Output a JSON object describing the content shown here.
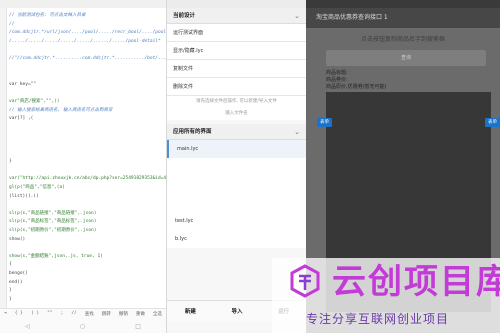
{
  "editor": {
    "status_bar_text": "",
    "lines": [
      {
        "text": "// 当前测试包名: 可点击文档入目录",
        "cls": "c-comment"
      },
      {
        "text": "//",
        "cls": "c-comment"
      },
      {
        "text": "/com.ddcjtr.*/url/json/..../pool/...../recr_bool/..../pool/...../auto-trend*",
        "cls": "c-comment"
      },
      {
        "text": "/...../...../...../...../...../....../...../pool-detail*",
        "cls": "c-comment"
      },
      {
        "text": "",
        "cls": ""
      },
      {
        "text": "//\"//com.ddcjtr.*..........com.ddcjtr.*.........../bot/.../pool/...../trendyPoolBest*",
        "cls": "c-comment"
      },
      {
        "text": "",
        "cls": ""
      },
      {
        "text": "",
        "cls": ""
      },
      {
        "text": "var key=\"\"",
        "cls": "c-kw"
      },
      {
        "text": "",
        "cls": ""
      },
      {
        "text": "var\"商店/搜索\",\"\",()",
        "cls": "c-str"
      },
      {
        "text": "// 输入搜索结果商店名, 输入商店名可点击到商家",
        "cls": "c-comment"
      },
      {
        "text": "var[?] ,(",
        "cls": "c-kw"
      },
      {
        "text": "",
        "cls": ""
      },
      {
        "text": "",
        "cls": ""
      },
      {
        "text": "",
        "cls": ""
      },
      {
        "text": "",
        "cls": ""
      },
      {
        "text": "}",
        "cls": "c-kw"
      },
      {
        "text": "",
        "cls": ""
      },
      {
        "text": "var(\"http://api.zhouxjk.cn/abc/dp.php?ser=25491829353&id=4\",.jpg)",
        "cls": "c-str"
      },
      {
        "text": "gl(p(\"商品\",\"信息\",(a)",
        "cls": "c-str"
      },
      {
        "text": "(list)((.((",
        "cls": "c-kw"
      },
      {
        "text": "",
        "cls": ""
      },
      {
        "text": "  sl(p(s,\"商品链接\",\"商品链接\",.json)",
        "cls": "c-str"
      },
      {
        "text": "  sl(p(s,\"商品标签\",\"商品标签\",.json)",
        "cls": "c-str"
      },
      {
        "text": "  sl(p(s,\"初期原价\",\"初期原价\",.json)",
        "cls": "c-str"
      },
      {
        "text": "  show()",
        "cls": "c-kw"
      },
      {
        "text": "",
        "cls": ""
      },
      {
        "text": "show(s,\"金额结账\",json,.js, true, 1)",
        "cls": "c-str"
      },
      {
        "text": "  {",
        "cls": "c-kw"
      },
      {
        "text": "    bengo()",
        "cls": "c-kw"
      },
      {
        "text": "    end()",
        "cls": "c-kw"
      },
      {
        "text": "  }",
        "cls": "c-kw"
      },
      {
        "text": "}",
        "cls": "c-kw"
      }
    ],
    "keyboard_keys": [
      "⇥",
      "{ }",
      "( )",
      "\"\"",
      ";",
      "//",
      "查找",
      "跳转",
      "撤销",
      "重做",
      "全选"
    ],
    "nav_buttons": [
      "◁",
      "○",
      "□"
    ]
  },
  "menu": {
    "section1_title": "当前设计",
    "section1_items": [
      "运行测试界面",
      "显示/隐藏.lyc",
      "复制文件",
      "删除文件"
    ],
    "hint": "请先选择文件后操作, 可以新建/导入文件",
    "hint2": "输入文件名",
    "section2_title": "应用所有的界面",
    "files": [
      {
        "name": "main.lyc",
        "selected": true
      },
      {
        "name": "",
        "selected": false
      },
      {
        "name": "",
        "selected": false
      },
      {
        "name": "",
        "selected": false
      },
      {
        "name": "test.lyc",
        "selected": false
      },
      {
        "name": "b.lyc",
        "selected": false
      }
    ],
    "buttons": [
      "新建",
      "导入",
      "运行"
    ]
  },
  "dialog": {
    "title": "淘宝商品优惠券查询接口 1",
    "prompt": "点击按钮复制商品名字到搜索框",
    "input_label": "查询",
    "result_line1": "商品标题:",
    "result_line2": "商品券价:",
    "result_line3": "商品原价,优惠券(暂无可能)",
    "tag_left": "表单",
    "tag_right": "表单"
  },
  "watermark": {
    "big_text": "云创项目库",
    "small_text": "专注分享互联网创业项目"
  },
  "colors": {
    "accent_blue": "#1a73c8",
    "watermark_purple": "#c23bd6"
  }
}
